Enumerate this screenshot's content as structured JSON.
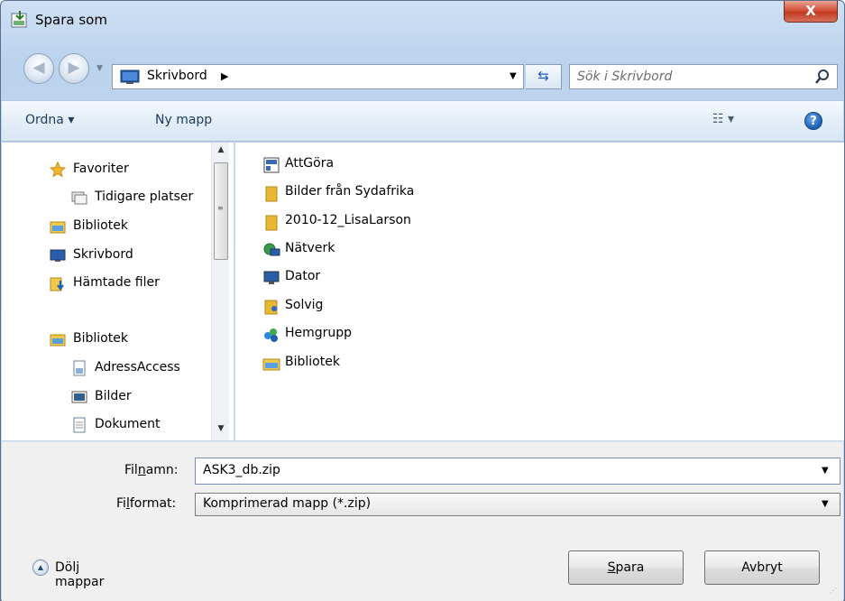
{
  "window": {
    "title": "Spara som",
    "close_label": "X"
  },
  "address": {
    "location": "Skrivbord",
    "search_placeholder": "Sök i Skrivbord"
  },
  "toolbar": {
    "organize": "Ordna ▾",
    "new_folder": "Ny mapp",
    "views_label": "☷ ▾",
    "help_label": "?"
  },
  "nav": {
    "favorites": "Favoriter",
    "items": [
      {
        "label": "Tidigare platser",
        "icon": "recent-places-icon"
      },
      {
        "label": "Bibliotek",
        "icon": "library-icon"
      },
      {
        "label": "Skrivbord",
        "icon": "desktop-icon"
      },
      {
        "label": "Hämtade filer",
        "icon": "downloads-icon"
      }
    ],
    "library": "Bibliotek",
    "library_items": [
      {
        "label": "AdressAccess",
        "icon": "document-icon"
      },
      {
        "label": "Bilder",
        "icon": "pictures-icon"
      },
      {
        "label": "Dokument",
        "icon": "documents-icon"
      }
    ]
  },
  "files": [
    {
      "label": "AttGöra",
      "icon": "shortcut-icon"
    },
    {
      "label": "Bilder från Sydafrika",
      "icon": "folder-icon"
    },
    {
      "label": "2010-12_LisaLarson",
      "icon": "folder-icon"
    },
    {
      "label": "Nätverk",
      "icon": "network-icon"
    },
    {
      "label": "Dator",
      "icon": "computer-icon"
    },
    {
      "label": "Solvig",
      "icon": "user-folder-icon"
    },
    {
      "label": "Hemgrupp",
      "icon": "homegroup-icon"
    },
    {
      "label": "Bibliotek",
      "icon": "library-icon"
    }
  ],
  "form": {
    "filename_label_pre": "Fil",
    "filename_label_u": "n",
    "filename_label_post": "amn:",
    "filename_value": "ASK3_db.zip",
    "filetype_label_pre": "Fi",
    "filetype_label_u": "l",
    "filetype_label_post": "format:",
    "filetype_value": "Komprimerad mapp (*.zip)",
    "hide_folders": "Dölj mappar",
    "save_u": "S",
    "save_rest": "para",
    "cancel": "Avbryt"
  }
}
